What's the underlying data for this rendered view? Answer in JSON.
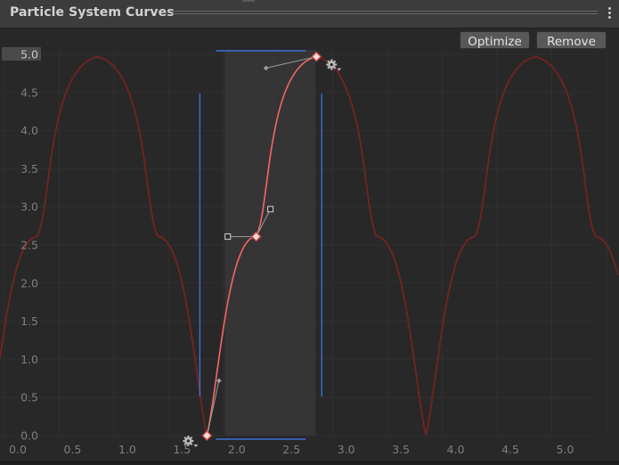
{
  "window": {
    "title": "Particle System Curves"
  },
  "toolbar": {
    "optimize_label": "Optimize",
    "remove_label": "Remove"
  },
  "colors": {
    "background": "#282828",
    "selection_band": "#353535",
    "curve": "#e86a6a",
    "curve_wrap": "#6d2424",
    "range_line": "#3d6fd6",
    "grid": "#2f2f2f",
    "axis_text": "#7e7e7e",
    "axis_max_text": "#c8c8c8"
  },
  "axes": {
    "x_ticks": [
      "0.0",
      "0.5",
      "1.0",
      "1.5",
      "2.0",
      "2.5",
      "3.0",
      "3.5",
      "4.0",
      "4.5",
      "5.0"
    ],
    "y_ticks": [
      "0.0",
      "0.5",
      "1.0",
      "1.5",
      "2.0",
      "2.5",
      "3.0",
      "3.5",
      "4.0",
      "4.5"
    ],
    "y_max_label": "5.0",
    "xlim": [
      0,
      5.5
    ],
    "ylim": [
      0,
      5
    ]
  },
  "chart_data": {
    "type": "line",
    "selected_range": [
      1.85,
      2.85
    ],
    "keys": [
      {
        "x": 1.85,
        "y": 0.0,
        "in_handle": {
          "x": 1.85,
          "y": 0.0
        },
        "out_handle": {
          "x": 1.96,
          "y": 0.72
        }
      },
      {
        "x": 2.3,
        "y": 2.61,
        "in_handle": {
          "x": 2.04,
          "y": 2.61
        },
        "out_handle": {
          "x": 2.43,
          "y": 2.97
        }
      },
      {
        "x": 2.85,
        "y": 4.97,
        "in_handle": {
          "x": 2.39,
          "y": 4.82
        },
        "out_handle": {
          "x": 2.85,
          "y": 4.97
        }
      }
    ],
    "wrap": "ping-pong"
  },
  "icons": {
    "key_settings": "gear-icon"
  }
}
